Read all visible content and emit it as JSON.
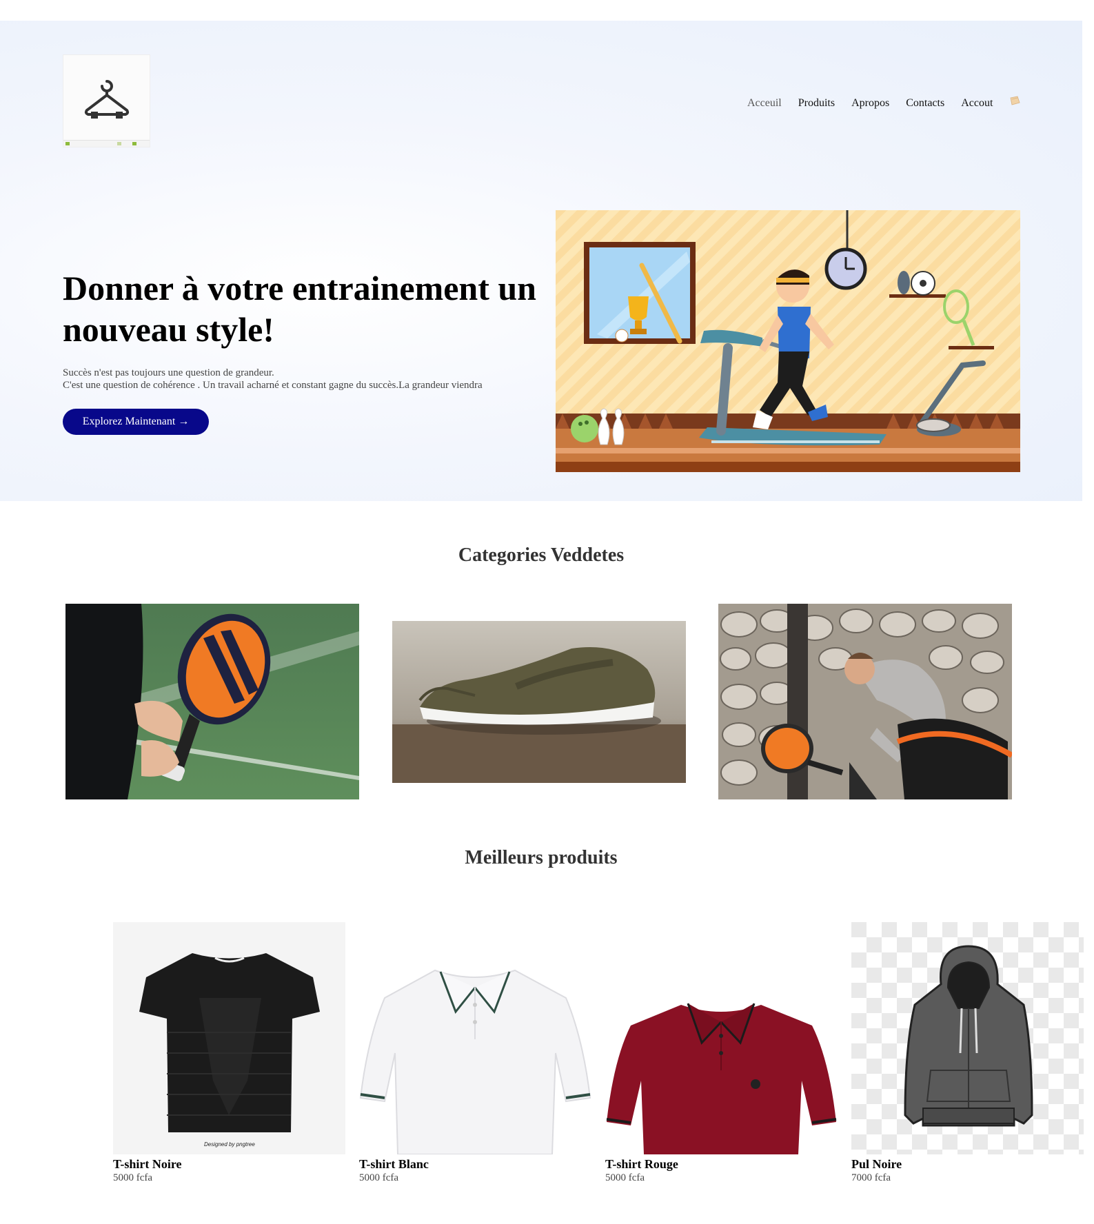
{
  "header": {
    "logo_icon": "hanger-icon",
    "nav": [
      {
        "label": "Acceuil",
        "active": true
      },
      {
        "label": "Produits"
      },
      {
        "label": "Apropos"
      },
      {
        "label": "Contacts"
      },
      {
        "label": "Accout"
      }
    ],
    "cart_icon": "cart-icon"
  },
  "hero": {
    "title": "Donner à votre entrainement un nouveau style!",
    "subtitle_line1": "Succès n'est pas toujours une question de grandeur.",
    "subtitle_line2": "C'est une question de cohérence . Un travail acharné et constant gagne du succès.La grandeur viendra",
    "cta_label": "Explorez Maintenant",
    "cta_arrow": "→",
    "button_color": "#08088a"
  },
  "categories": {
    "title": "Categories Veddetes",
    "items": [
      {
        "image": "padel-racket-photo"
      },
      {
        "image": "olive-sneakers-photo"
      },
      {
        "image": "athlete-with-bag-photo"
      }
    ]
  },
  "products": {
    "title": "Meilleurs produits",
    "items": [
      {
        "name": "T-shirt Noire",
        "price": "5000 fcfa",
        "color": "#1b1b1b"
      },
      {
        "name": "T-shirt Blanc",
        "price": "5000 fcfa",
        "color": "#f4f4f6"
      },
      {
        "name": "T-shirt Rouge",
        "price": "5000 fcfa",
        "color": "#8a1124"
      },
      {
        "name": "Pul Noire",
        "price": "7000 fcfa",
        "color": "#555555"
      }
    ],
    "watermark": "Designed by pngtree"
  }
}
